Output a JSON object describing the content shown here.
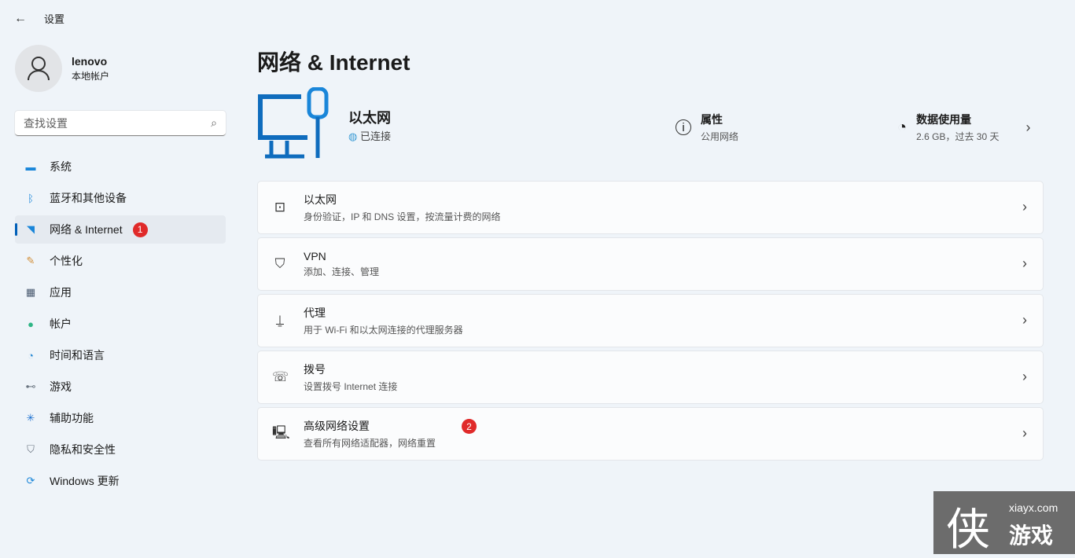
{
  "window": {
    "title": "设置"
  },
  "profile": {
    "name": "lenovo",
    "account": "本地帐户"
  },
  "search": {
    "placeholder": "查找设置"
  },
  "nav": [
    {
      "label": "系统",
      "icon": "monitor-icon"
    },
    {
      "label": "蓝牙和其他设备",
      "icon": "bluetooth-icon"
    },
    {
      "label": "网络 & Internet",
      "icon": "wifi-icon",
      "active": true,
      "badge": "1"
    },
    {
      "label": "个性化",
      "icon": "brush-icon"
    },
    {
      "label": "应用",
      "icon": "apps-icon"
    },
    {
      "label": "帐户",
      "icon": "person-icon"
    },
    {
      "label": "时间和语言",
      "icon": "globe-clock-icon"
    },
    {
      "label": "游戏",
      "icon": "gamepad-icon"
    },
    {
      "label": "辅助功能",
      "icon": "accessibility-icon"
    },
    {
      "label": "隐私和安全性",
      "icon": "shield-icon"
    },
    {
      "label": "Windows 更新",
      "icon": "update-icon"
    }
  ],
  "page": {
    "title": "网络 & Internet"
  },
  "hero": {
    "name": "以太网",
    "status": "已连接",
    "properties": {
      "title": "属性",
      "sub": "公用网络"
    },
    "usage": {
      "title": "数据使用量",
      "sub": "2.6 GB，过去 30 天"
    }
  },
  "cards": [
    {
      "title": "以太网",
      "sub": "身份验证，IP 和 DNS 设置，按流量计费的网络",
      "icon": "ethernet-icon"
    },
    {
      "title": "VPN",
      "sub": "添加、连接、管理",
      "icon": "vpn-shield-icon"
    },
    {
      "title": "代理",
      "sub": "用于 Wi-Fi 和以太网连接的代理服务器",
      "icon": "proxy-icon"
    },
    {
      "title": "拨号",
      "sub": "设置拨号 Internet 连接",
      "icon": "dialup-icon"
    },
    {
      "title": "高级网络设置",
      "sub": "查看所有网络适配器，网络重置",
      "icon": "advanced-network-icon",
      "badge": "2"
    }
  ],
  "watermark": {
    "site": "xiayx.com",
    "char": "侠",
    "name": "游戏"
  }
}
